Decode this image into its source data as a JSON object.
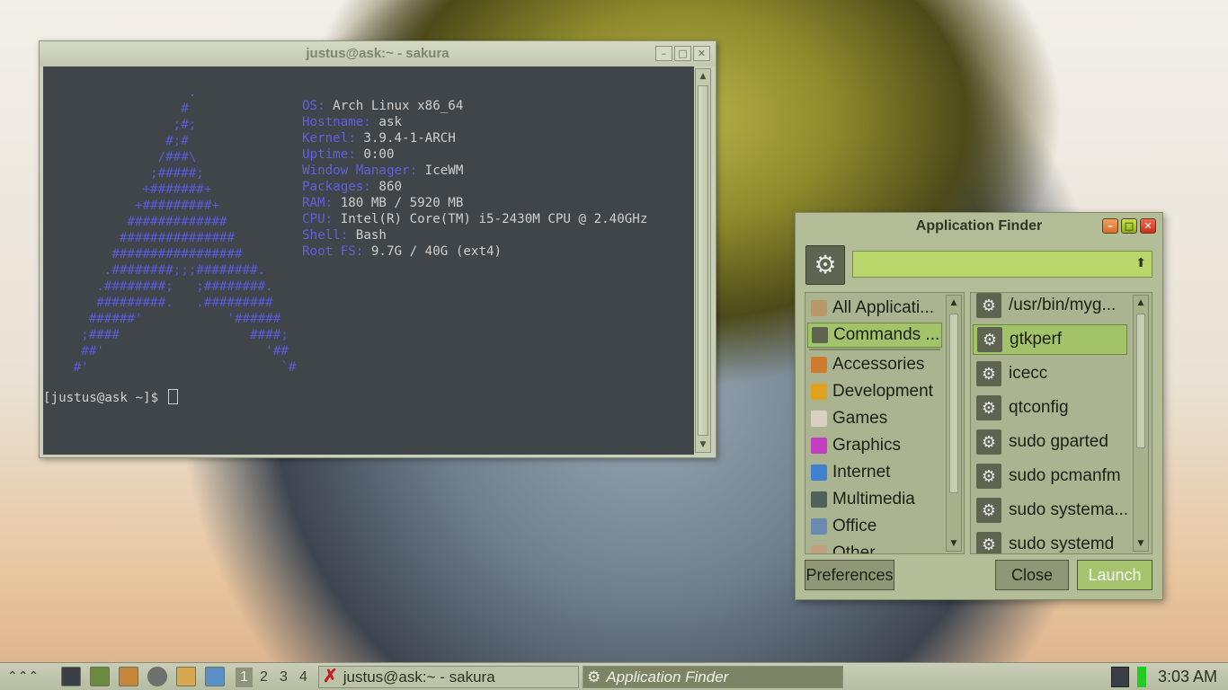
{
  "terminal": {
    "title": "justus@ask:~ - sakura",
    "ascii_logo": "                  .\n                 #\n                ;#;\n               #;#\n              /###\\\n             ;#####;\n            +#######+\n           +#########+\n          #############\n         ###############\n        #################\n       .########;;;########.\n      .########;   ;########.\n      #########.   .#########\n     ######'           '######\n    ;####                 ####;\n    ##'                     '##\n   #'                         `#",
    "info": [
      {
        "key": "OS:",
        "value": " Arch Linux x86_64"
      },
      {
        "key": "Hostname:",
        "value": " ask"
      },
      {
        "key": "Kernel:",
        "value": " 3.9.4-1-ARCH"
      },
      {
        "key": "Uptime:",
        "value": " 0:00"
      },
      {
        "key": "Window Manager:",
        "value": " IceWM"
      },
      {
        "key": "Packages:",
        "value": " 860"
      },
      {
        "key": "RAM:",
        "value": " 180 MB / 5920 MB"
      },
      {
        "key": "CPU:",
        "value": " Intel(R) Core(TM) i5-2430M CPU @ 2.40GHz"
      },
      {
        "key": "Shell:",
        "value": " Bash"
      },
      {
        "key": "Root FS:",
        "value": " 9.7G / 40G (ext4)"
      }
    ],
    "prompt": "[justus@ask ~]$ "
  },
  "finder": {
    "title": "Application Finder",
    "search_value": "",
    "categories": [
      {
        "label": "All Applicati...",
        "icon": "all-apps-icon",
        "color": "#b89a6a"
      },
      {
        "label": "Commands ...",
        "icon": "gear-icon",
        "color": "#5f6450"
      },
      {
        "label": "Accessories",
        "icon": "accessories-icon",
        "color": "#d07a30"
      },
      {
        "label": "Development",
        "icon": "development-icon",
        "color": "#e0a020"
      },
      {
        "label": "Games",
        "icon": "games-icon",
        "color": "#d8d0c0"
      },
      {
        "label": "Graphics",
        "icon": "graphics-icon",
        "color": "#c040c0"
      },
      {
        "label": "Internet",
        "icon": "internet-icon",
        "color": "#4080d0"
      },
      {
        "label": "Multimedia",
        "icon": "multimedia-icon",
        "color": "#50605a"
      },
      {
        "label": "Office",
        "icon": "office-icon",
        "color": "#6a8ab0"
      },
      {
        "label": "Other",
        "icon": "other-icon",
        "color": "#c0a080"
      }
    ],
    "commands": [
      "/usr/bin/myg...",
      "gtkperf",
      "icecc",
      "qtconfig",
      "sudo gparted",
      "sudo pcmanfm",
      "sudo systema...",
      "sudo systemd"
    ],
    "buttons": {
      "preferences": "Preferences",
      "close": "Close",
      "launch": "Launch"
    }
  },
  "taskbar": {
    "workspaces": [
      "1",
      "2",
      "3",
      "4"
    ],
    "tasks": [
      "justus@ask:~ - sakura",
      "Application Finder"
    ],
    "clock": "3:03 AM"
  }
}
